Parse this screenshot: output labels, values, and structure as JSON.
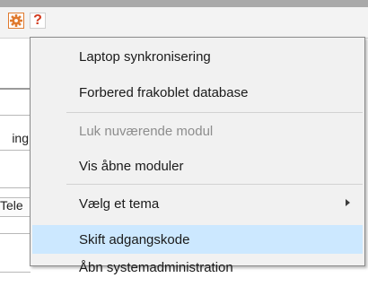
{
  "toolbar": {
    "settings_icon": "gear-icon",
    "help_label": "?",
    "accent_color": "#e07a2e"
  },
  "background": {
    "fragments": [
      "ing",
      "Tele"
    ]
  },
  "context_menu": {
    "items": [
      {
        "label": "Laptop synkronisering",
        "state": "enabled"
      },
      {
        "label": "Forbered frakoblet database",
        "state": "enabled"
      },
      {
        "label": "Luk nuværende modul",
        "state": "disabled"
      },
      {
        "label": "Vis åbne moduler",
        "state": "enabled"
      },
      {
        "label": "Vælg et tema",
        "state": "enabled",
        "has_submenu": true
      },
      {
        "label": "Skift adgangskode",
        "state": "highlighted"
      },
      {
        "label": "Åbn systemadministration",
        "state": "enabled"
      }
    ],
    "highlight_color": "#cce8ff",
    "disabled_color": "#8d8d8d"
  }
}
